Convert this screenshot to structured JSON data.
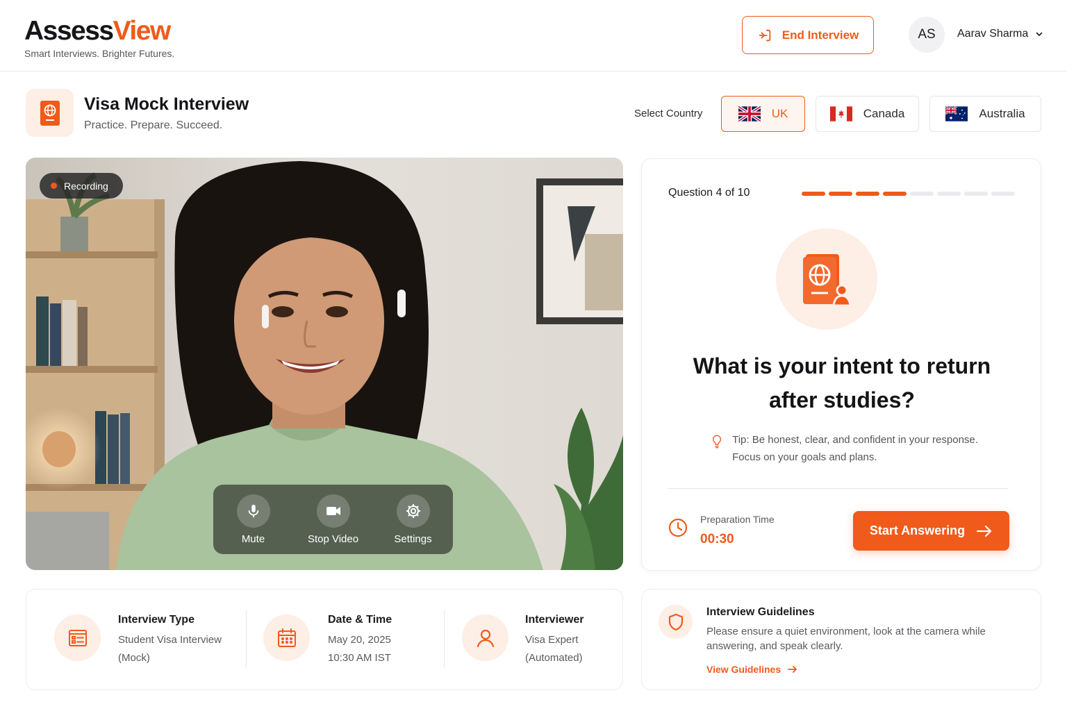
{
  "brand": {
    "name_part1": "Assess",
    "name_part2": "View",
    "tagline": "Smart Interviews. Brighter Futures."
  },
  "header": {
    "end_interview_label": "End Interview",
    "user_initials": "AS",
    "user_name": "Aarav Sharma"
  },
  "page": {
    "title": "Visa Mock Interview",
    "subtitle": "Practice. Prepare. Succeed."
  },
  "country_selector": {
    "label": "Select Country",
    "selected": "UK",
    "options": [
      {
        "label": "UK"
      },
      {
        "label": "Canada"
      },
      {
        "label": "Australia"
      }
    ]
  },
  "video": {
    "recording_label": "Recording",
    "controls": [
      {
        "label": "Mute",
        "icon": "microphone-icon"
      },
      {
        "label": "Stop Video",
        "icon": "video-camera-icon"
      },
      {
        "label": "Settings",
        "icon": "gear-icon"
      }
    ]
  },
  "question": {
    "counter": "Question 4 of 10",
    "current": 4,
    "total": 10,
    "text": "What is your intent to return after studies?",
    "tip": "Tip: Be honest, clear, and confident in your response. Focus on your goals and plans.",
    "prep_label": "Preparation Time",
    "prep_time": "00:30",
    "start_label": "Start Answering"
  },
  "details": [
    {
      "title": "Interview Type",
      "line1": "Student Visa Interview",
      "line2": "(Mock)",
      "icon": "form-icon"
    },
    {
      "title": "Date & Time",
      "line1": "May 20, 2025",
      "line2": "10:30 AM IST",
      "icon": "calendar-icon"
    },
    {
      "title": "Interviewer",
      "line1": "Visa Expert",
      "line2": "(Automated)",
      "icon": "user-icon"
    }
  ],
  "guidelines": {
    "title": "Interview Guidelines",
    "text": "Please ensure a quiet environment, look at the camera while answering, and speak clearly.",
    "link": "View Guidelines"
  },
  "colors": {
    "accent": "#f05a1a",
    "accent_light": "#fdeee6",
    "text_dark": "#1b1b1f",
    "text_muted": "#5a5a61"
  }
}
